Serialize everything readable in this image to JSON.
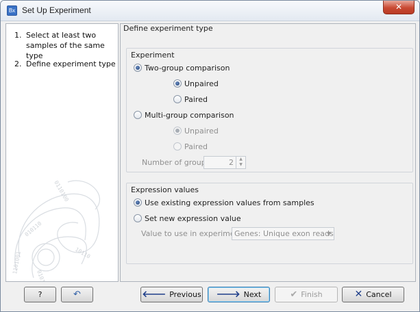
{
  "window": {
    "title": "Set Up Experiment",
    "app_icon_text": "Bx",
    "close_glyph": "✕"
  },
  "steps": [
    {
      "num": "1.",
      "label": "Select at least two samples of the same type"
    },
    {
      "num": "2.",
      "label": "Define experiment type"
    }
  ],
  "main": {
    "section_title": "Define experiment type",
    "experiment": {
      "group_title": "Experiment",
      "two_group": "Two-group comparison",
      "unpaired": "Unpaired",
      "paired": "Paired",
      "multi_group": "Multi-group comparison",
      "multi_unpaired": "Unpaired",
      "multi_paired": "Paired",
      "num_groups_label": "Number of groups",
      "num_groups_value": "2",
      "spin_up": "▲",
      "spin_down": "▼"
    },
    "expression": {
      "group_title": "Expression values",
      "use_existing": "Use existing expression values from samples",
      "set_new": "Set new expression value",
      "value_label": "Value to use in experiment",
      "value_selected": "Genes: Unique exon reads",
      "dropdown_arrow": "▼"
    }
  },
  "footer": {
    "help_label": "?",
    "reset_icon": "↶",
    "previous_label": "Previous",
    "next_label": "Next",
    "finish_label": "Finish",
    "cancel_label": "Cancel",
    "previous_icon": "🡐",
    "next_icon": "🡒",
    "finish_icon": "✔",
    "cancel_icon": "✕"
  },
  "colors": {
    "accent": "#3c7fb1",
    "close_red": "#c94a33",
    "arrow_blue": "#1f3f8a"
  }
}
